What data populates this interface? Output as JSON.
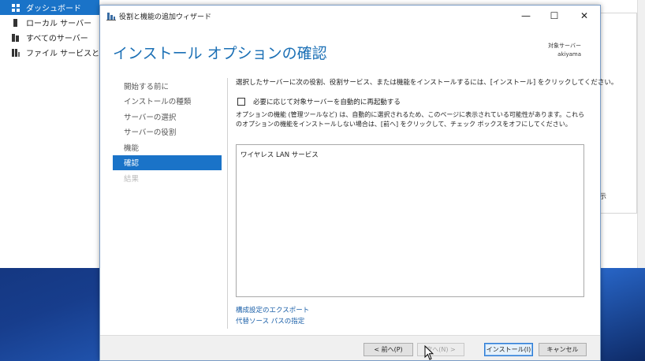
{
  "server_manager": {
    "sidebar": [
      {
        "label": "ダッシュボード",
        "active": true,
        "icon": "dashboard-icon"
      },
      {
        "label": "ローカル サーバー",
        "active": false,
        "icon": "server-icon"
      },
      {
        "label": "すべてのサーバー",
        "active": false,
        "icon": "servers-icon"
      },
      {
        "label": "ファイル サービスと記憶",
        "active": false,
        "icon": "file-services-icon"
      }
    ],
    "right_fragment": "示"
  },
  "wizard": {
    "title": "役割と機能の追加ウィザード",
    "controls": {
      "minimize": "—",
      "maximize": "☐",
      "close": "✕"
    },
    "header_title": "インストール オプションの確認",
    "target_server_label": "対象サーバー",
    "target_server_name": "akiyama",
    "steps": [
      {
        "label": "開始する前に",
        "state": "done"
      },
      {
        "label": "インストールの種類",
        "state": "done"
      },
      {
        "label": "サーバーの選択",
        "state": "done"
      },
      {
        "label": "サーバーの役割",
        "state": "done"
      },
      {
        "label": "機能",
        "state": "done"
      },
      {
        "label": "確認",
        "state": "active"
      },
      {
        "label": "結果",
        "state": "disabled"
      }
    ],
    "instruction": "選択したサーバーに次の役割、役割サービス、または機能をインストールするには、[インストール] をクリックしてください。",
    "restart_checkbox_label": "必要に応じて対象サーバーを自動的に再起動する",
    "restart_checked": false,
    "optional_note_line1": "オプションの機能 (管理ツールなど) は、自動的に選択されるため、このページに表示されている可能性があります。これら",
    "optional_note_line2": "のオプションの機能をインストールしない場合は、[前へ] をクリックして、チェック ボックスをオフにしてください。",
    "features": [
      "ワイヤレス LAN サービス"
    ],
    "link_export": "構成設定のエクスポート",
    "link_alt_source": "代替ソース パスの指定",
    "buttons": {
      "prev": "< 前へ(P)",
      "next": "次へ(N) >",
      "install": "インストール(I)",
      "cancel": "キャンセル"
    }
  },
  "colors": {
    "accent": "#1a73c8",
    "title_blue": "#1a6fb5",
    "link": "#1a5fa8"
  }
}
